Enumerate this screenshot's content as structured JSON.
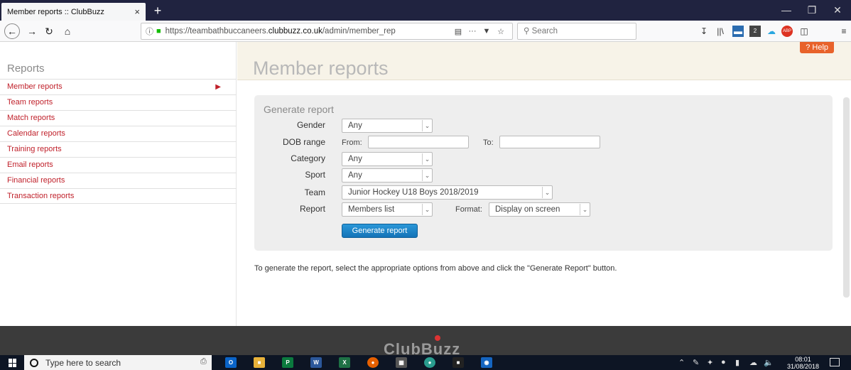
{
  "browser": {
    "tab_title": "Member reports :: ClubBuzz",
    "tab_close": "×",
    "new_tab": "+",
    "url_prefix": "https://teambathbuccaneers.",
    "url_domain": "clubbuzz.co.uk",
    "url_path": "/admin/member_rep",
    "search_placeholder": "Search",
    "window_minimize": "—",
    "window_restore": "❐",
    "window_close": "✕",
    "adblock_count": "2"
  },
  "sidebar": {
    "title": "Reports",
    "items": [
      {
        "label": "Member reports",
        "active": true
      },
      {
        "label": "Team reports"
      },
      {
        "label": "Match reports"
      },
      {
        "label": "Calendar reports"
      },
      {
        "label": "Training reports"
      },
      {
        "label": "Email reports"
      },
      {
        "label": "Financial reports"
      },
      {
        "label": "Transaction reports"
      }
    ]
  },
  "main": {
    "title": "Member reports",
    "help_label": "? Help",
    "panel_title": "Generate report",
    "form": {
      "gender_label": "Gender",
      "gender_value": "Any",
      "dob_label": "DOB range",
      "dob_from_label": "From:",
      "dob_to_label": "To:",
      "dob_from_value": "",
      "dob_to_value": "",
      "category_label": "Category",
      "category_value": "Any",
      "sport_label": "Sport",
      "sport_value": "Any",
      "team_label": "Team",
      "team_value": "Junior Hockey U18 Boys 2018/2019",
      "report_label": "Report",
      "report_value": "Members list",
      "format_label": "Format:",
      "format_value": "Display on screen",
      "generate_button": "Generate report"
    },
    "info_text": "To generate the report, select the appropriate options from above and click the \"Generate Report\" button."
  },
  "footer": {
    "logo_text": "ClubBuzz"
  },
  "taskbar": {
    "search_placeholder": "Type here to search",
    "time": "08:01",
    "date": "31/08/2018"
  }
}
